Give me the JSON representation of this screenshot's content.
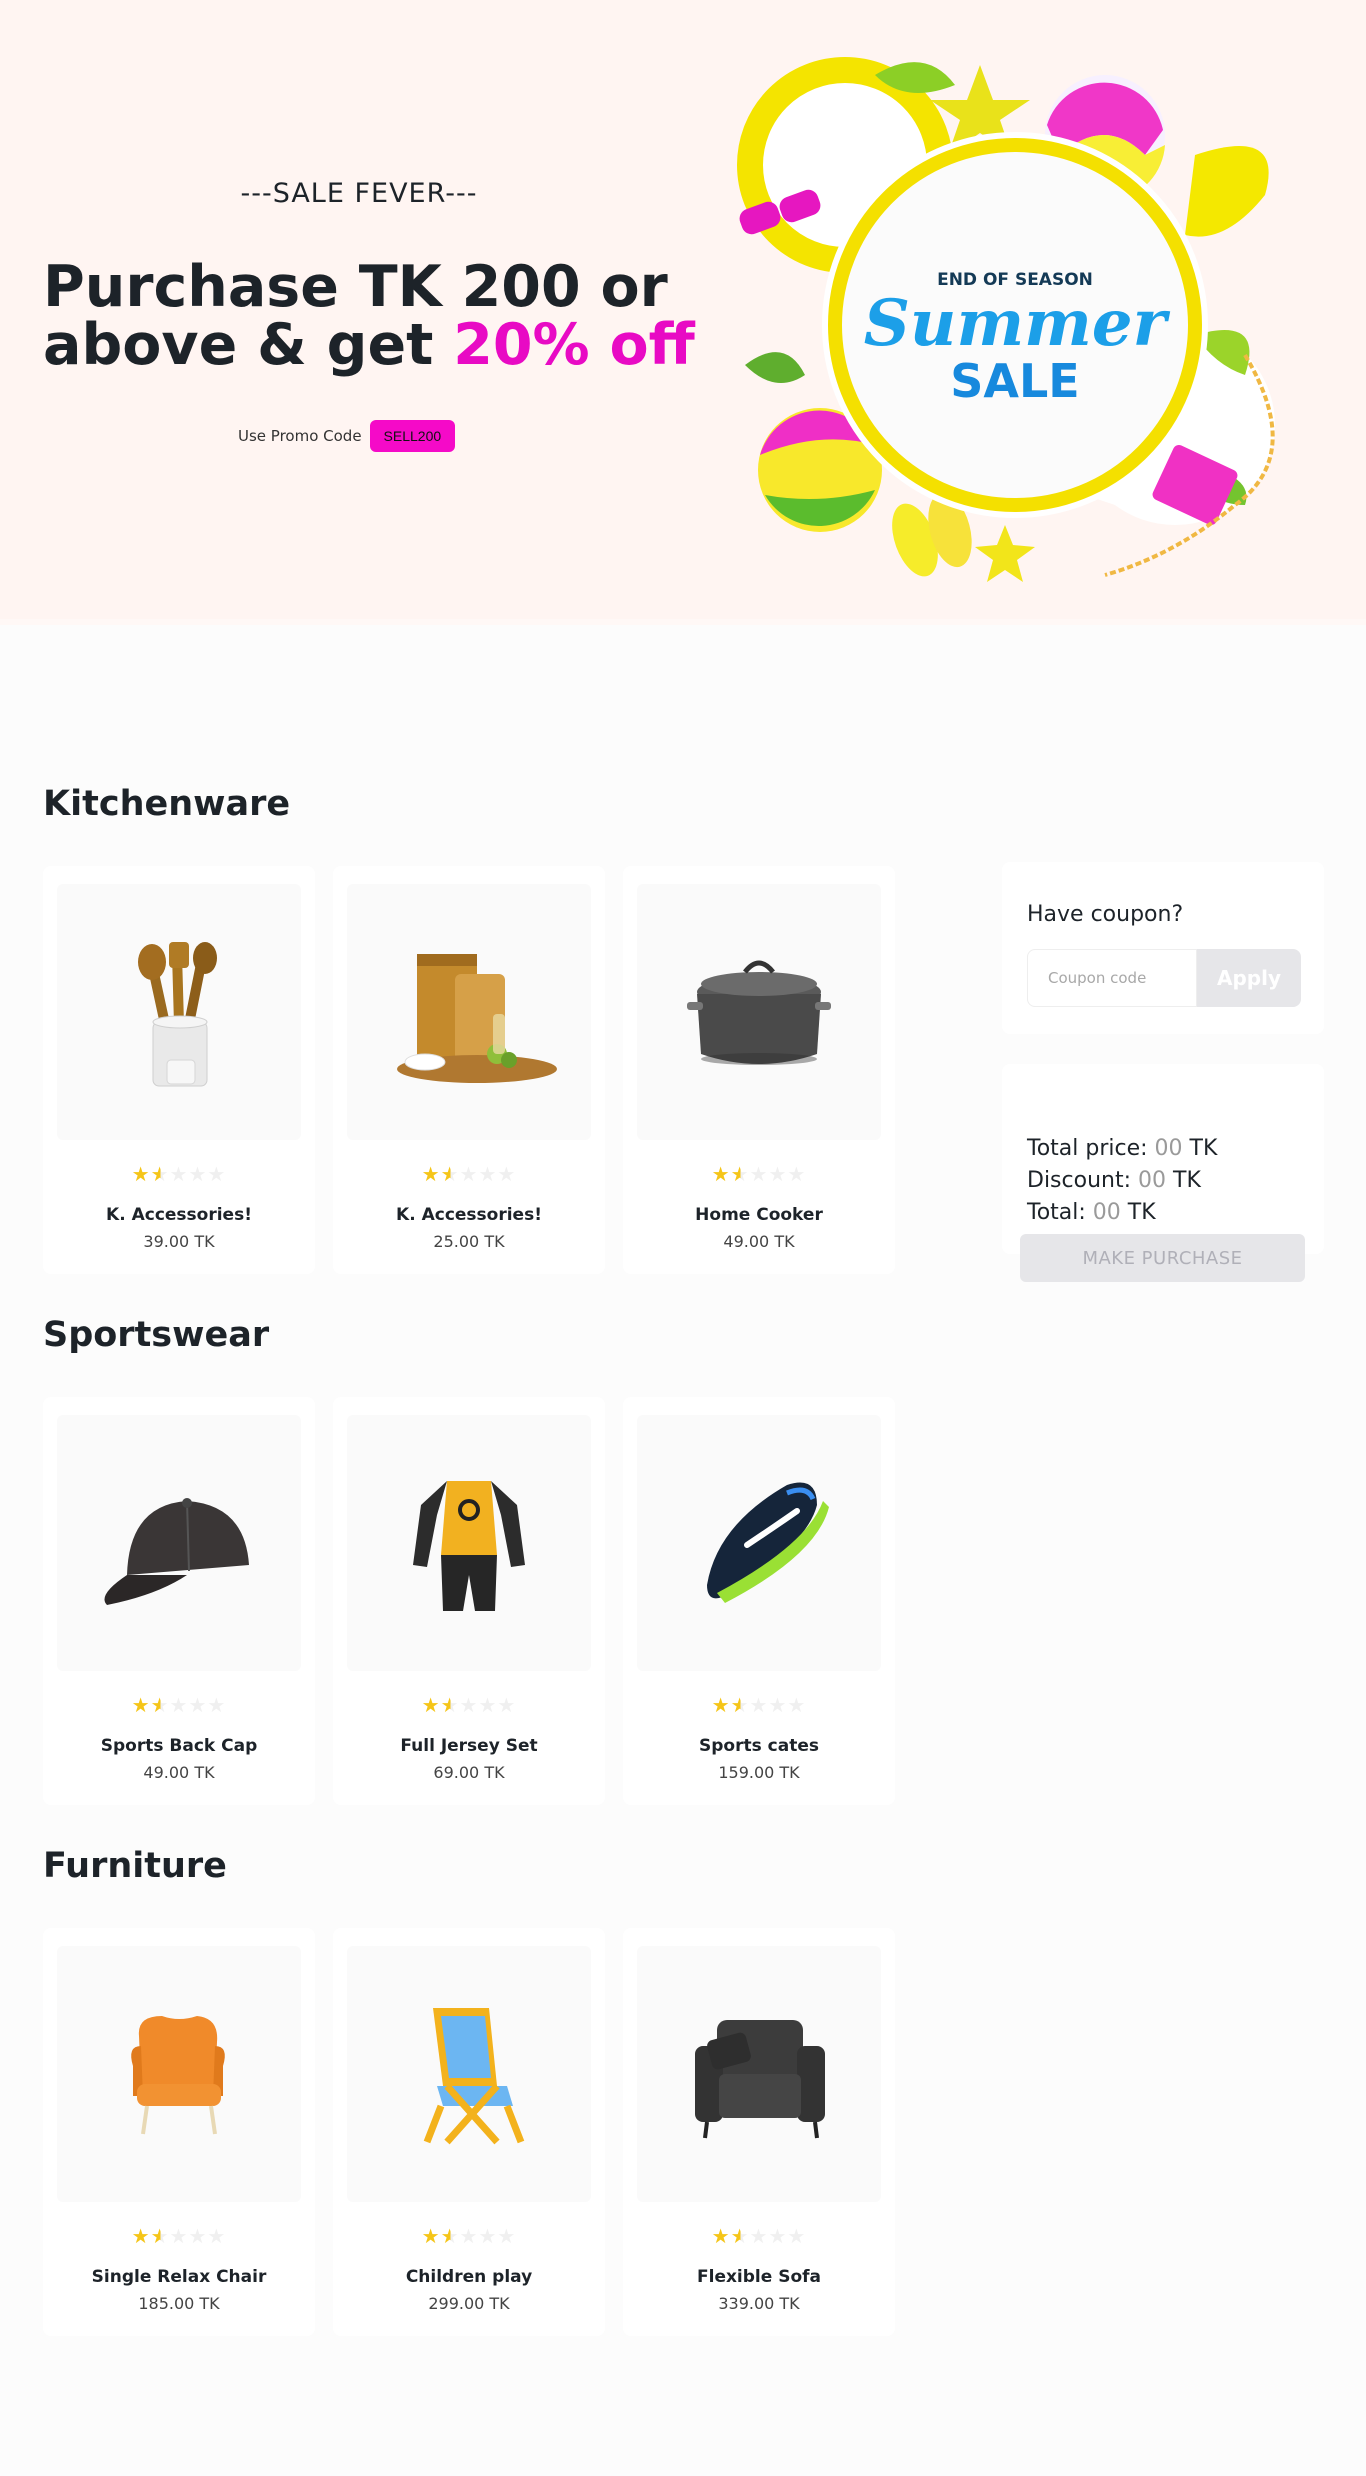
{
  "hero": {
    "tagline": "---SALE FEVER---",
    "headline_line1": "Purchase TK 200 or",
    "headline_line2_prefix": "above & get ",
    "headline_highlight": "20% off",
    "promo_label": "Use Promo Code",
    "promo_code": "SELL200",
    "banner_top": "END OF SEASON",
    "banner_script": "Summer",
    "banner_bottom": "SALE"
  },
  "sections": [
    {
      "title": "Kitchenware",
      "products": [
        {
          "name": "K. Accessories!",
          "price": "39.00 TK",
          "rating": 1.5,
          "icon": "kitchen-utensils-icon"
        },
        {
          "name": "K. Accessories!",
          "price": "25.00 TK",
          "rating": 1.5,
          "icon": "cutting-board-icon"
        },
        {
          "name": "Home Cooker",
          "price": "49.00 TK",
          "rating": 1.5,
          "icon": "cooking-pot-icon"
        }
      ]
    },
    {
      "title": "Sportswear",
      "products": [
        {
          "name": "Sports Back Cap",
          "price": "49.00 TK",
          "rating": 1.5,
          "icon": "cap-icon"
        },
        {
          "name": "Full Jersey Set",
          "price": "69.00 TK",
          "rating": 1.5,
          "icon": "jersey-icon"
        },
        {
          "name": "Sports cates",
          "price": "159.00 TK",
          "rating": 1.5,
          "icon": "sneaker-icon"
        }
      ]
    },
    {
      "title": "Furniture",
      "products": [
        {
          "name": "Single Relax Chair",
          "price": "185.00 TK",
          "rating": 1.5,
          "icon": "armchair-icon"
        },
        {
          "name": "Children play",
          "price": "299.00 TK",
          "rating": 1.5,
          "icon": "folding-chair-icon"
        },
        {
          "name": "Flexible Sofa",
          "price": "339.00 TK",
          "rating": 1.5,
          "icon": "sofa-icon"
        }
      ]
    }
  ],
  "coupon": {
    "title": "Have coupon?",
    "placeholder": "Coupon code",
    "apply_label": "Apply"
  },
  "summary": {
    "total_price_label": "Total price:",
    "total_price_value": "00",
    "discount_label": "Discount:",
    "discount_value": "00",
    "total_label": "Total:",
    "total_value": "00",
    "currency": "TK",
    "purchase_label": "MAKE PURCHASE"
  },
  "colors": {
    "hero_bg": "#fff5f2",
    "accent_pink": "#e80ac4",
    "star": "#f5c518",
    "text_dark": "#1d2329"
  }
}
